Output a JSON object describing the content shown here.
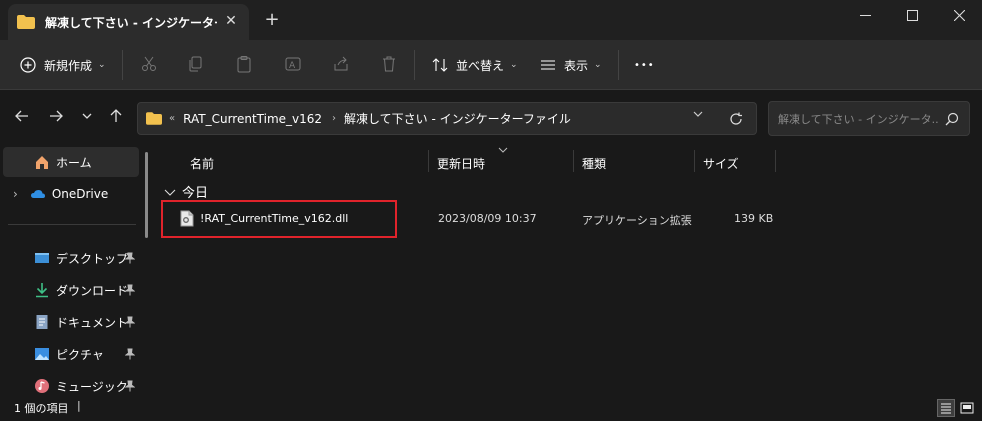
{
  "window": {
    "tab_title": "解凍して下さい - インジケーターファ",
    "new_tab": "+",
    "close_tab": "✕",
    "minimize": "—",
    "maximize": "☐",
    "close": "✕"
  },
  "toolbar": {
    "new_label": "新規作成",
    "sort_label": "並べ替え",
    "view_label": "表示",
    "more_label": "•••",
    "dropdown_chevron": "⌄"
  },
  "address": {
    "overflow": "«",
    "crumbs": [
      "RAT_CurrentTime_v162",
      "解凍して下さい - インジケーターファイル"
    ],
    "sep": "›",
    "search_placeholder": "解凍して下さい - インジケータ..."
  },
  "sidebar": {
    "items": [
      {
        "label": "ホーム",
        "icon": "home-icon"
      },
      {
        "label": "OneDrive",
        "icon": "cloud-icon"
      },
      {
        "label": "デスクトップ",
        "icon": "desktop-icon"
      },
      {
        "label": "ダウンロード",
        "icon": "download-icon"
      },
      {
        "label": "ドキュメント",
        "icon": "document-icon"
      },
      {
        "label": "ピクチャ",
        "icon": "picture-icon"
      },
      {
        "label": "ミュージック",
        "icon": "music-icon"
      }
    ],
    "expand_glyph": "›"
  },
  "columns": {
    "name": "名前",
    "date": "更新日時",
    "type": "種類",
    "size": "サイズ"
  },
  "group": {
    "label": "今日",
    "chevron": "⌄"
  },
  "files": [
    {
      "name": "!RAT_CurrentTime_v162.dll",
      "date": "2023/08/09 10:37",
      "type": "アプリケーション拡張",
      "size": "139 KB"
    }
  ],
  "status": {
    "count": "1 個の項目"
  },
  "colors": {
    "accent_highlight": "#e0232b",
    "folder": "#f2c14e",
    "background": "#191919"
  }
}
